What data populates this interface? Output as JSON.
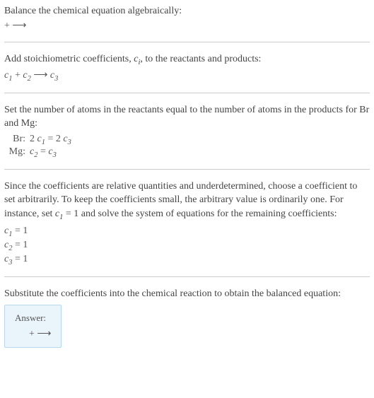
{
  "section1": {
    "line1": "Balance the chemical equation algebraically:",
    "reaction": " + ⟶ "
  },
  "section2": {
    "line1_pre": "Add stoichiometric coefficients, ",
    "ci": "c",
    "ci_sub": "i",
    "line1_post": ", to the reactants and products:",
    "eq_c1": "c",
    "eq_s1": "1",
    "eq_plus": " + ",
    "eq_c2": "c",
    "eq_s2": "2",
    "eq_arrow": " ⟶ ",
    "eq_c3": "c",
    "eq_s3": "3"
  },
  "section3": {
    "line1": "Set the number of atoms in the reactants equal to the number of atoms in the products for Br and Mg:",
    "rows": [
      {
        "label": "Br:",
        "lhs_coef": "2 ",
        "lhs_c": "c",
        "lhs_s": "1",
        "eq": " = ",
        "rhs_coef": "2 ",
        "rhs_c": "c",
        "rhs_s": "3"
      },
      {
        "label": "Mg:",
        "lhs_coef": "",
        "lhs_c": "c",
        "lhs_s": "2",
        "eq": " = ",
        "rhs_coef": "",
        "rhs_c": "c",
        "rhs_s": "3"
      }
    ]
  },
  "section4": {
    "para_pre": "Since the coefficients are relative quantities and underdetermined, choose a coefficient to set arbitrarily. To keep the coefficients small, the arbitrary value is ordinarily one. For instance, set ",
    "c": "c",
    "s": "1",
    "para_mid": " = 1 and solve the system of equations for the remaining coefficients:",
    "coefs": [
      {
        "c": "c",
        "s": "1",
        "val": " = 1"
      },
      {
        "c": "c",
        "s": "2",
        "val": " = 1"
      },
      {
        "c": "c",
        "s": "3",
        "val": " = 1"
      }
    ]
  },
  "section5": {
    "line1": "Substitute the coefficients into the chemical reaction to obtain the balanced equation:",
    "answer_label": "Answer:",
    "answer_content": " + ⟶ "
  }
}
